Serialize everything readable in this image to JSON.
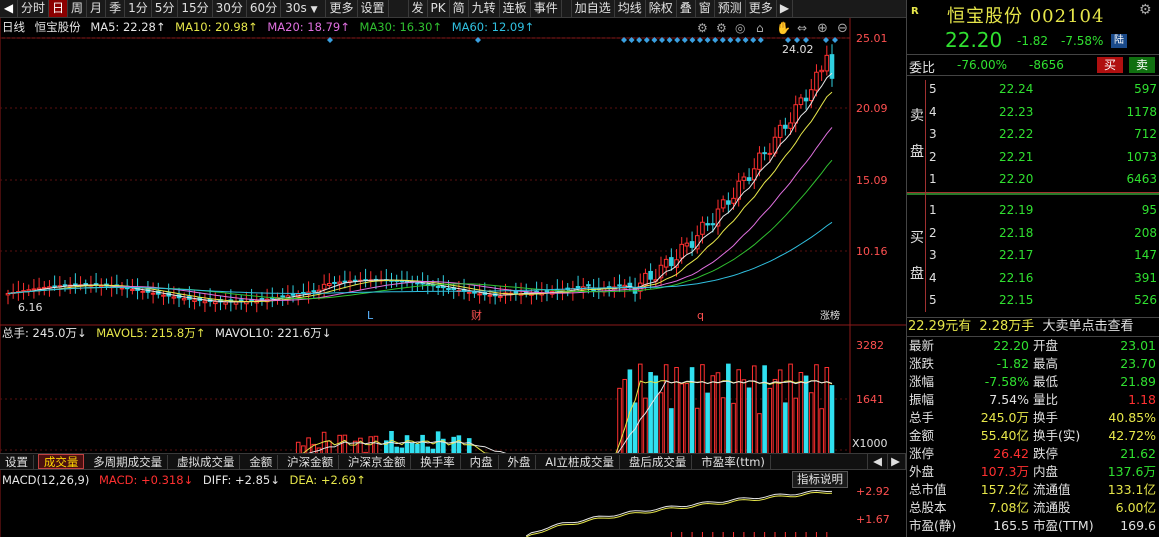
{
  "toolbar": {
    "items": [
      "分时",
      "日",
      "周",
      "月",
      "季",
      "1分",
      "5分",
      "15分",
      "30分",
      "60分"
    ],
    "active_index": 1,
    "period_select": "30s",
    "more1": "更多",
    "settings": "设置",
    "right_items": [
      "发",
      "PK",
      "简",
      "九转",
      "连板",
      "事件"
    ],
    "right_items2": [
      "加自选",
      "均线",
      "除权",
      "叠",
      "窗",
      "预测",
      "更多"
    ]
  },
  "ma_legend": {
    "title": "日线",
    "stock": "恒宝股份",
    "ma5": "MA5: 22.28↑",
    "ma10": "MA10: 20.98↑",
    "ma20": "MA20: 18.79↑",
    "ma30": "MA30: 16.30↑",
    "ma60": "MA60: 12.09↑"
  },
  "price_axis": {
    "ticks": [
      "25.01",
      "20.09",
      "15.09",
      "10.16"
    ],
    "high_label": "24.02",
    "low_label": "6.16"
  },
  "event_markers": [
    "L",
    "财",
    "q",
    "涨榜"
  ],
  "volume_legend": {
    "total": "总手: 245.0万↓",
    "mavol5": "MAVOL5: 215.8万↑",
    "mavol10": "MAVOL10: 221.6万↓"
  },
  "volume_axis": {
    "ticks": [
      "3282",
      "1641"
    ],
    "unit": "X1000"
  },
  "subtabs": [
    "设置",
    "成交量",
    "多周期成交量",
    "虚拟成交量",
    "金额",
    "沪深金额",
    "沪深京金额",
    "换手率",
    "内盘",
    "外盘",
    "AI立桩成交量",
    "盘后成交量",
    "市盈率(ttm)"
  ],
  "subtabs_active": 1,
  "macd_legend": {
    "name": "MACD(12,26,9)",
    "macd": "MACD: +0.318↓",
    "diff": "DIFF: +2.85↓",
    "dea": "DEA: +2.69↑"
  },
  "indicator_button": "指标说明",
  "macd_axis": {
    "ticks": [
      "+2.92",
      "+1.67"
    ]
  },
  "quote": {
    "badge": "R",
    "name": "恒宝股份 002104",
    "price": "22.20",
    "change": "-1.82",
    "pct": "-7.58%",
    "lu": "陆",
    "weibi_label": "委比",
    "weibi_pct": "-76.00%",
    "weibi_diff": "-8656",
    "buy": "买",
    "sell": "卖",
    "sell_label": [
      "卖",
      "盘"
    ],
    "buy_label": [
      "买",
      "盘"
    ],
    "asks": [
      {
        "lv": "5",
        "price": "22.24",
        "vol": "597"
      },
      {
        "lv": "4",
        "price": "22.23",
        "vol": "1178"
      },
      {
        "lv": "3",
        "price": "22.22",
        "vol": "712"
      },
      {
        "lv": "2",
        "price": "22.21",
        "vol": "1073"
      },
      {
        "lv": "1",
        "price": "22.20",
        "vol": "6463"
      }
    ],
    "bids": [
      {
        "lv": "1",
        "price": "22.19",
        "vol": "95"
      },
      {
        "lv": "2",
        "price": "22.18",
        "vol": "208"
      },
      {
        "lv": "3",
        "price": "22.17",
        "vol": "147"
      },
      {
        "lv": "4",
        "price": "22.16",
        "vol": "391"
      },
      {
        "lv": "5",
        "price": "22.15",
        "vol": "526"
      }
    ],
    "banner_a": "22.29元有",
    "banner_b": "2.28万手",
    "banner_c": "大卖单点击查看",
    "stats": [
      {
        "k": "最新",
        "v": "22.20",
        "vc": "dn",
        "k2": "开盘",
        "v2": "23.01",
        "v2c": "dn"
      },
      {
        "k": "涨跌",
        "v": "-1.82",
        "vc": "dn",
        "k2": "最高",
        "v2": "23.70",
        "v2c": "dn"
      },
      {
        "k": "涨幅",
        "v": "-7.58%",
        "vc": "dn",
        "k2": "最低",
        "v2": "21.89",
        "v2c": "dn"
      },
      {
        "k": "振幅",
        "v": "7.54%",
        "vc": "wt",
        "k2": "量比",
        "v2": "1.18",
        "v2c": "up"
      },
      {
        "k": "总手",
        "v": "245.0万",
        "vc": "nu",
        "k2": "换手",
        "v2": "40.85%",
        "v2c": "nu"
      },
      {
        "k": "金额",
        "v": "55.40亿",
        "vc": "nu",
        "k2": "换手(实)",
        "v2": "42.72%",
        "v2c": "nu"
      },
      {
        "k": "涨停",
        "v": "26.42",
        "vc": "up",
        "k2": "跌停",
        "v2": "21.62",
        "v2c": "dn"
      },
      {
        "k": "外盘",
        "v": "107.3万",
        "vc": "up",
        "k2": "内盘",
        "v2": "137.6万",
        "v2c": "dn"
      },
      {
        "k": "总市值",
        "v": "157.2亿",
        "vc": "nu",
        "k2": "流通值",
        "v2": "133.1亿",
        "v2c": "nu"
      },
      {
        "k": "总股本",
        "v": "7.08亿",
        "vc": "nu",
        "k2": "流通股",
        "v2": "6.00亿",
        "v2c": "nu"
      },
      {
        "k": "市盈(静)",
        "v": "165.5",
        "vc": "wt",
        "k2": "市盈(TTM)",
        "v2": "169.6",
        "v2c": "wt"
      }
    ]
  }
}
